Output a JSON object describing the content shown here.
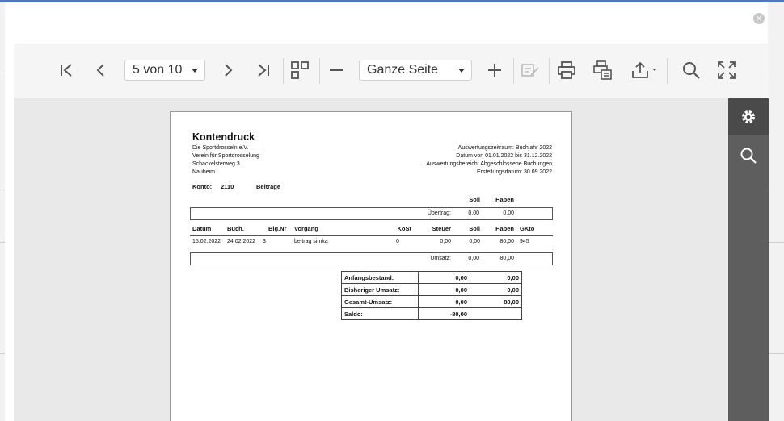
{
  "toolbar": {
    "page_selector": "5 von 10",
    "zoom_selector": "Ganze Seite"
  },
  "report": {
    "title": "Kontendruck",
    "address": [
      "Die Sportdrosseln e.V.",
      "Verein für Sportdrosselung",
      "Schackelsterweg 3",
      " Nauheim"
    ],
    "meta": [
      "Auswertungszeitraum: Buchjahr 2022",
      "Datum  von  01.01.2022  bis  31.12.2022",
      "Auswertungsbereich: Abgeschlossene Buchungen",
      "Erstellungsdatum: 30.09.2022"
    ],
    "konto_label": "Konto:",
    "konto_number": "2110",
    "konto_name": "Beiträge",
    "head_soll": "Soll",
    "head_haben": "Haben",
    "uebertrag_label": "Übertrag:",
    "uebertrag_soll": "0,00",
    "uebertrag_haben": "0,00",
    "columns": {
      "datum": "Datum",
      "buch": "Buch.",
      "blg": "Blg.Nr",
      "vorgang": "Vorgang",
      "kost": "KoSt",
      "steuer": "Steuer",
      "soll": "Soll",
      "haben": "Haben",
      "gkto": "GKto"
    },
    "rows": [
      {
        "datum": "15.02.2022",
        "buch": "24.02.2022",
        "blg": "3",
        "vorgang": "beitrag simka",
        "kost": "0",
        "steuer": "0,00",
        "soll": "0,00",
        "haben": "80,00",
        "gkto": "945"
      }
    ],
    "umsatz_label": "Umsatz:",
    "umsatz_soll": "0,00",
    "umsatz_haben": "80,00",
    "summary": [
      {
        "label": "Anfangsbestand:",
        "soll": "0,00",
        "haben": "0,00"
      },
      {
        "label": "Bisheriger Umsatz:",
        "soll": "0,00",
        "haben": "0,00"
      },
      {
        "label": "Gesamt-Umsatz:",
        "soll": "0,00",
        "haben": "80,00"
      }
    ],
    "saldo_label": "Saldo:",
    "saldo_value": "-80,00"
  }
}
